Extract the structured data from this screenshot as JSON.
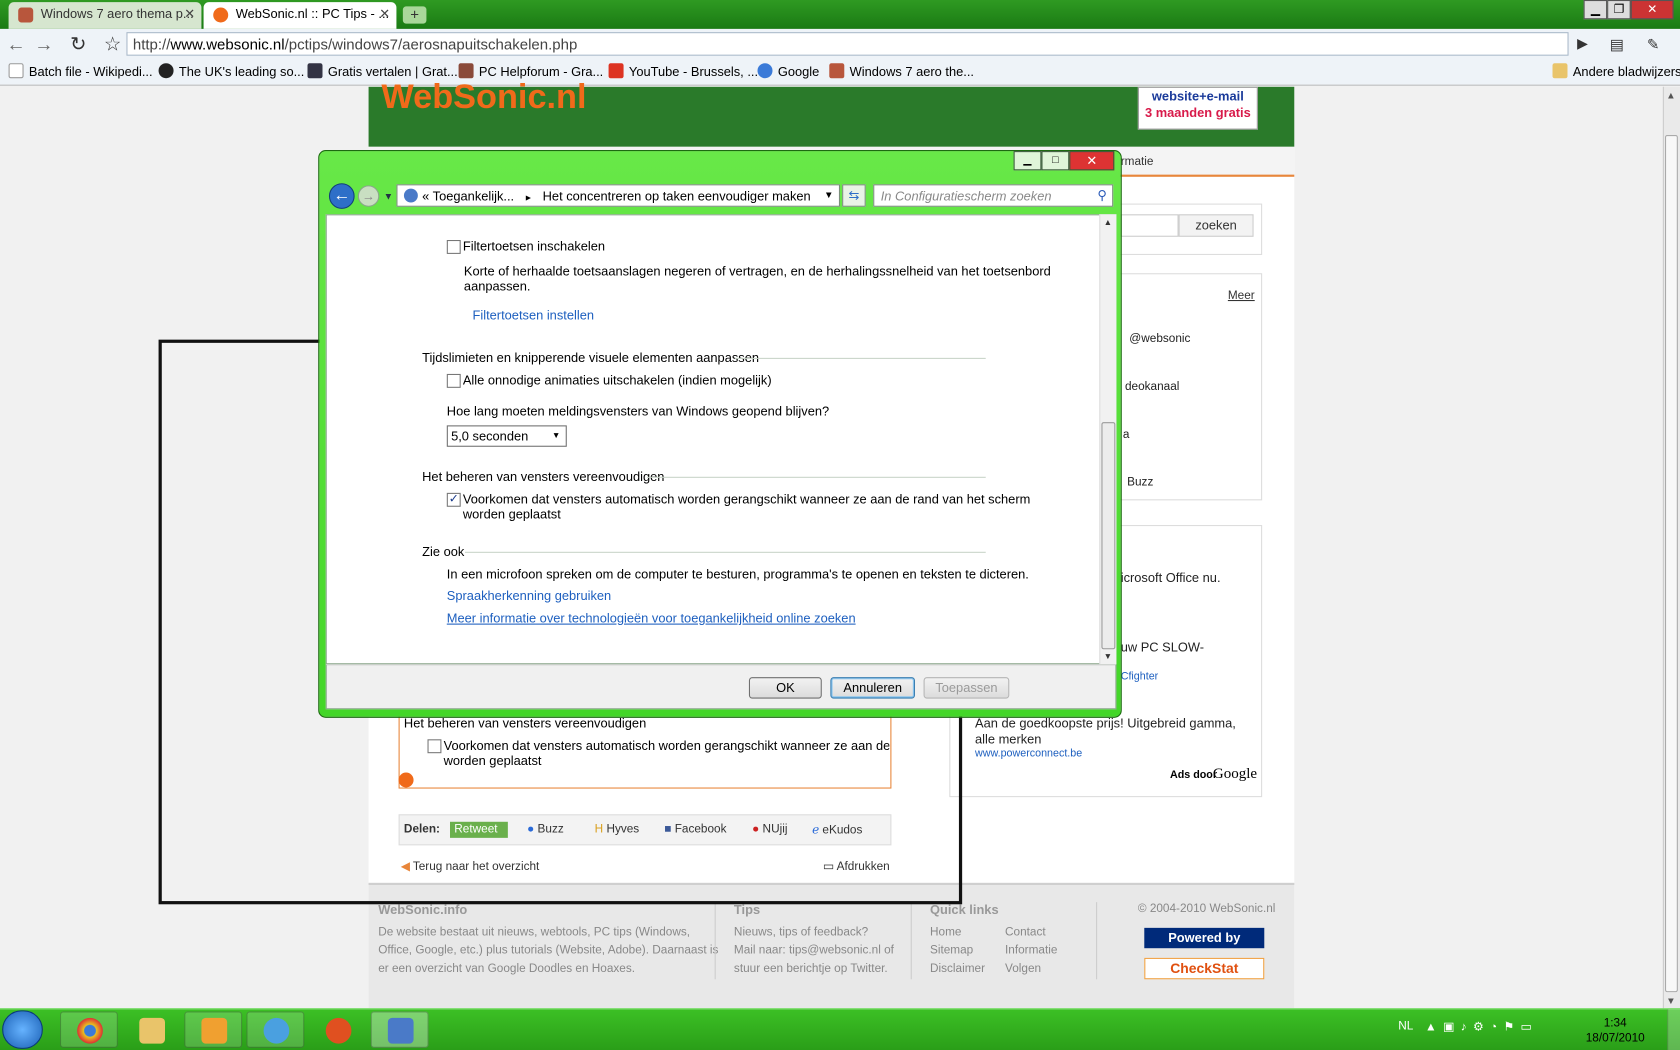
{
  "browser": {
    "tabs": [
      {
        "title": "Windows 7 aero thema p...",
        "active": false
      },
      {
        "title": "WebSonic.nl :: PC Tips - ...",
        "active": true
      }
    ],
    "new_tab": "+",
    "url_prefix": "http://",
    "url_host": "www.websonic.nl",
    "url_path": "/pctips/windows7/aerosnapuitschakelen.php",
    "bookmarks": [
      {
        "label": "Batch file - Wikipedi...",
        "icon": "wikipedia-icon"
      },
      {
        "label": "The UK's leading so...",
        "icon": "net-icon"
      },
      {
        "label": "Gratis vertalen | Grat...",
        "icon": "translate-icon"
      },
      {
        "label": "PC Helpforum - Gra...",
        "icon": "forum-icon"
      },
      {
        "label": "YouTube - Brussels, ...",
        "icon": "youtube-icon"
      },
      {
        "label": "Google",
        "icon": "google-icon"
      },
      {
        "label": "Windows 7 aero the...",
        "icon": "page-icon"
      }
    ],
    "other_bookmarks": "Andere bladwijzers"
  },
  "website": {
    "logo": "WebSonic.nl",
    "ad_line1": "website+e-mail",
    "ad_line2": "3 maanden gratis",
    "nav_partial": "rmatie",
    "search_button": "zoeken",
    "more_link": "Meer",
    "sidebar_items": [
      "@websonic",
      "deokanaal",
      "a",
      "Buzz"
    ],
    "ad_office": "icrosoft Office nu.",
    "ad_slow": "uw PC SLOW-",
    "ad_slow_link": "Cfighter",
    "ad_cheap": "Aan de goedkoopste prijs! Uitgebreid gamma, alle merken",
    "ad_cheap_link": "www.powerconnect.be",
    "ads_by": "Ads door",
    "ads_google": "Google",
    "article_section": "Het beheren van vensters vereenvoudigen",
    "article_checkbox": "Voorkomen dat vensters automatisch worden gerangschikt wanneer ze aan de rand v",
    "article_checkbox_line2": "worden geplaatst",
    "share_label": "Delen:",
    "share_items": [
      "Retweet",
      "Buzz",
      "Hyves",
      "Facebook",
      "NUjij",
      "eKudos"
    ],
    "back_link": "Terug naar het overzicht",
    "print_link": "Afdrukken",
    "footer": {
      "col1_title": "WebSonic.info",
      "col1_text": [
        "De website bestaat uit nieuws, webtools, PC tips (Windows,",
        "Office, Google, etc.) plus tutorials (Website, Adobe). Daarnaast is",
        "er een overzicht van Google Doodles en Hoaxes."
      ],
      "col2_title": "Tips",
      "col2_text": [
        "Nieuws, tips of feedback?",
        "Mail naar: tips@websonic.nl of",
        "stuur een berichtje op Twitter."
      ],
      "col3_title": "Quick links",
      "links_a": [
        "Home",
        "Sitemap",
        "Disclaimer"
      ],
      "links_b": [
        "Contact",
        "Informatie",
        "Volgen"
      ],
      "copyright": "©  2004-2010 WebSonic.nl",
      "powered": "Powered by",
      "checkstat": "CheckStat"
    }
  },
  "dialog": {
    "breadcrumb_prefix": "«",
    "breadcrumb_1": "Toegankelijk...",
    "breadcrumb_sep": "►",
    "breadcrumb_2": "Het concentreren op taken eenvoudiger maken",
    "search_placeholder": "In Configuratiescherm zoeken",
    "filter_label": "Filtertoetsen inschakelen",
    "filter_desc_1": "Korte of herhaalde toetsaanslagen negeren of vertragen, en de herhalingssnelheid van het toetsenbord",
    "filter_desc_2": "aanpassen.",
    "filter_link": "Filtertoetsen instellen",
    "section_time": "Tijdslimieten en knipperende visuele elementen aanpassen",
    "animations_label": "Alle onnodige animaties uitschakelen (indien mogelijk)",
    "notify_question": "Hoe lang moeten meldingsvensters van Windows geopend blijven?",
    "notify_value": "5,0 seconden",
    "section_windows": "Het beheren van vensters vereenvoudigen",
    "snap_label_1": "Voorkomen dat vensters automatisch worden gerangschikt wanneer ze aan de rand van het scherm",
    "snap_label_2": "worden geplaatst",
    "snap_checked": true,
    "section_see_also": "Zie ook",
    "see_also_text": "In een microfoon spreken om de computer te besturen, programma's te openen en teksten te dicteren.",
    "speech_link": "Spraakherkenning gebruiken",
    "more_info_link": "Meer informatie over technologieën voor toegankelijkheid online zoeken",
    "ok": "OK",
    "cancel": "Annuleren",
    "apply": "Toepassen"
  },
  "taskbar": {
    "language": "NL",
    "time": "1:34",
    "date": "18/07/2010"
  },
  "colors": {
    "taskbar_green": "#2a9e18",
    "dialog_frame": "#43d628",
    "link_blue": "#1d5fbf",
    "brand_orange": "#f06a1a"
  }
}
